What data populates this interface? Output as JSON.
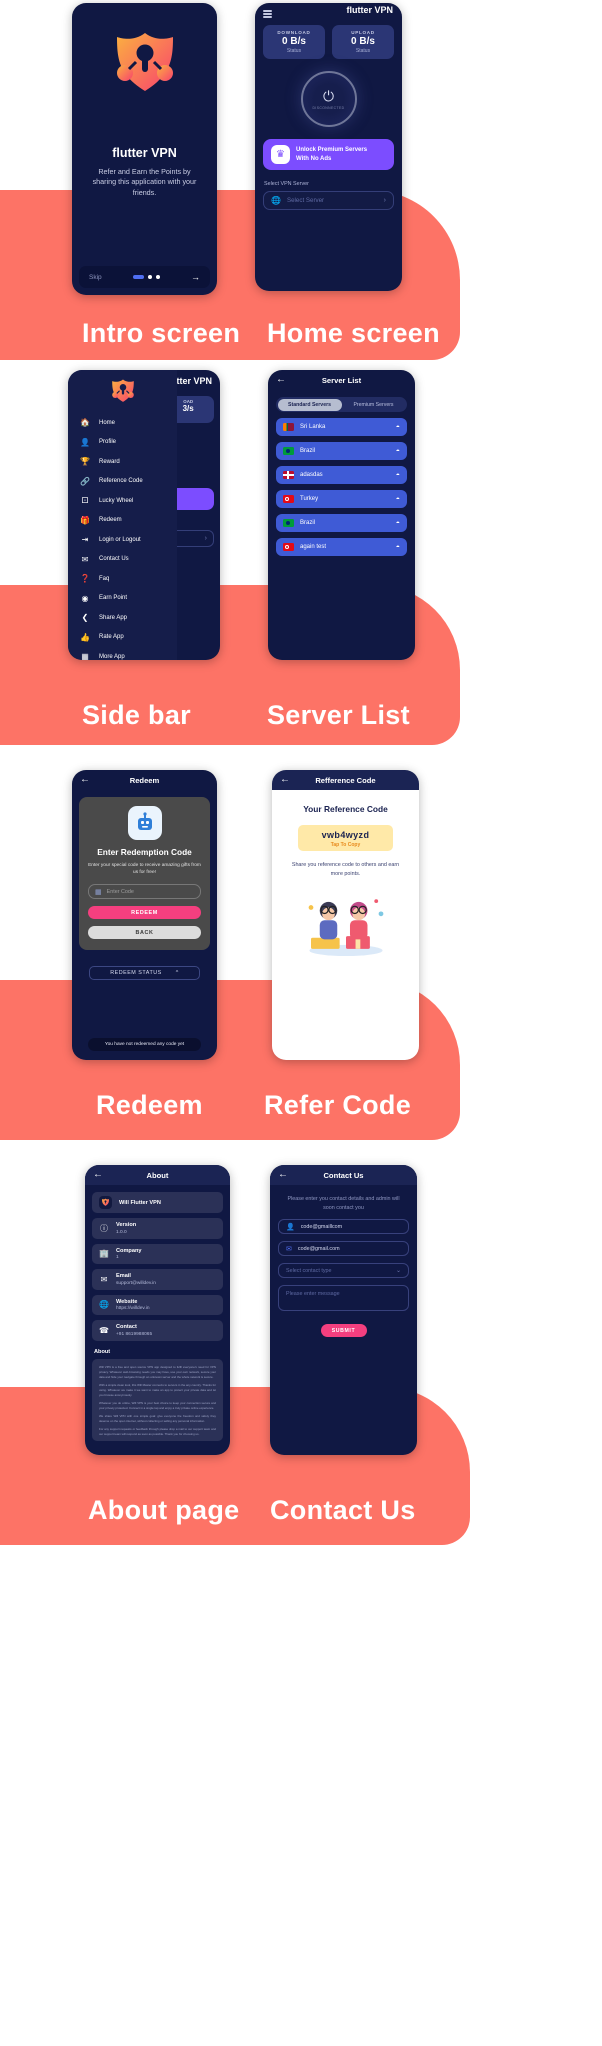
{
  "brand": {
    "name": "flutter VPN",
    "accent": "#fd7366",
    "dark": "#101843",
    "purple": "#7c4dff",
    "pink": "#f43f7f",
    "blue": "#3f5bd6"
  },
  "sections": [
    {
      "id": "intro",
      "label": "Intro screen"
    },
    {
      "id": "home",
      "label": "Home screen"
    },
    {
      "id": "sidebar",
      "label": "Side bar"
    },
    {
      "id": "server",
      "label": "Server List"
    },
    {
      "id": "redeem",
      "label": "Redeem"
    },
    {
      "id": "refer",
      "label": "Refer Code"
    },
    {
      "id": "about",
      "label": "About page"
    },
    {
      "id": "contact",
      "label": "Contact Us"
    }
  ],
  "intro": {
    "title": "flutter VPN",
    "subtitle": "Refer and Earn the Points by sharing this application with your friends.",
    "skip": "Skip",
    "next_icon": "arrow-right-icon",
    "dots": 3,
    "active_dot": 0
  },
  "home": {
    "app_title": "flutter VPN",
    "menu_icon": "hamburger-icon",
    "download": {
      "key": "DOWNLOAD",
      "value": "0 B/s",
      "status": "Status"
    },
    "upload": {
      "key": "UPLOAD",
      "value": "0 B/s",
      "status": "Status"
    },
    "power": {
      "icon": "power-icon",
      "state": "DISCONNECTED"
    },
    "promo": {
      "line1": "Unlock Premium Servers",
      "line2": "With No Ads",
      "icon": "crown-icon"
    },
    "select_label": "Select VPN Server",
    "select_placeholder": "Select Server",
    "globe_icon": "globe-icon",
    "chevron_icon": "chevron-right-icon"
  },
  "sidebar": {
    "behind": {
      "app_title": "flutter VPN",
      "download_key": "OAD",
      "download_value": "3/s"
    },
    "logo_icon": "shield-key-icon",
    "items": [
      {
        "label": "Home",
        "icon": "home-icon"
      },
      {
        "label": "Profile",
        "icon": "person-icon"
      },
      {
        "label": "Reward",
        "icon": "trophy-icon"
      },
      {
        "label": "Reference Code",
        "icon": "link-icon"
      },
      {
        "label": "Lucky Wheel",
        "icon": "dice-icon"
      },
      {
        "label": "Redeem",
        "icon": "gift-icon"
      },
      {
        "label": "Login or Logout",
        "icon": "login-icon"
      },
      {
        "label": "Contact Us",
        "icon": "mail-icon"
      },
      {
        "label": "Faq",
        "icon": "question-icon"
      },
      {
        "label": "Earn Point",
        "icon": "coin-icon"
      },
      {
        "label": "Share App",
        "icon": "share-icon"
      },
      {
        "label": "Rate App",
        "icon": "thumbs-up-icon"
      },
      {
        "label": "More App",
        "icon": "grid-icon"
      }
    ]
  },
  "server": {
    "title": "Server List",
    "back_icon": "back-arrow-icon",
    "tabs": [
      {
        "label": "Standard Servers",
        "active": true
      },
      {
        "label": "Premium Servers",
        "active": false
      }
    ],
    "rows": [
      {
        "name": "Sri Lanka",
        "flag": "sri-lanka",
        "signal": "wifi-icon"
      },
      {
        "name": "Brazil",
        "flag": "brazil",
        "signal": "wifi-icon"
      },
      {
        "name": "adasdas",
        "flag": "norway",
        "signal": "wifi-icon"
      },
      {
        "name": "Turkey",
        "flag": "turkey",
        "signal": "wifi-icon"
      },
      {
        "name": "Brazil",
        "flag": "brazil",
        "signal": "wifi-icon"
      },
      {
        "name": "again test",
        "flag": "turkey",
        "signal": "wifi-icon"
      }
    ]
  },
  "redeem": {
    "title": "Redeem",
    "back_icon": "back-arrow-icon",
    "card_icon": "redeem-robot-icon",
    "heading": "Enter Redemption Code",
    "paragraph": "Enter your special code to receive amazing gifts from us for free!",
    "input_placeholder": "Enter Code",
    "input_icon": "qr-code-icon",
    "primary_button": "REDEEM",
    "secondary_button": "BACK",
    "status_label": "REDEEM STATUS",
    "status_chevron": "chevron-up-icon",
    "toast": "You have not redeemed any code yet"
  },
  "refer": {
    "title": "Refference Code",
    "back_icon": "back-arrow-icon",
    "heading": "Your Reference Code",
    "code": "vwb4wyzd",
    "tap_hint": "Tap To Copy",
    "subtitle": "Share you reference code to others and earn more points.",
    "illustration": "people-sharing-illustration"
  },
  "about": {
    "title": "About",
    "back_icon": "back-arrow-icon",
    "app_name": "Will Flutter VPN",
    "app_icon": "shield-key-icon",
    "rows": [
      {
        "key": "Version",
        "value": "1.0.0",
        "icon": "info-icon"
      },
      {
        "key": "Company",
        "value": "1",
        "icon": "building-icon"
      },
      {
        "key": "Email",
        "value": "support@willdev.in",
        "icon": "mail-icon"
      },
      {
        "key": "Website",
        "value": "https://willdev.in",
        "icon": "globe-icon"
      },
      {
        "key": "Contact",
        "value": "+91 8619988065",
        "icon": "phone-icon"
      }
    ],
    "about_heading": "About",
    "about_text_1": "Will VPN is a free and open source VPN app designed to fulfil everyone's need for VPN privacy. Whatever web-browsing needs you may have, use your own network, secure your data and hide your navigate through an unknown server and the whole network is secure.",
    "about_text_2": "With a simple clean look, this Will Master connects to servers in the any country. Thanks for using. Whatever we make it we want to make an app to protect your private data and let you browse anonymously.",
    "about_text_3": "Whatever you do online, Will VPN is your best choice to keep your connection secure and your privacy protected. Connect in a single tap and enjoy a truly private online experience.",
    "about_text_4": "We share Will VPN with one simple goal: give everyone the freedom and safety they deserve on the open internet, without collecting or selling any personal information.",
    "about_text_5": "For any support requests or feedback through please drop a mail to our support team and our support team will respond as soon as possible. Thank you for choosing us."
  },
  "contact": {
    "title": "Contact Us",
    "back_icon": "back-arrow-icon",
    "lead": "Please enter you contact details and admin will soon contact you",
    "name_value": "code@gmaillcom",
    "name_icon": "person-icon",
    "email_value": "code@gmail.com",
    "email_icon": "mail-icon",
    "select_placeholder": "Select contact type",
    "select_chevron": "chevron-down-icon",
    "message_placeholder": "Please enter message",
    "submit": "SUBMIT"
  }
}
